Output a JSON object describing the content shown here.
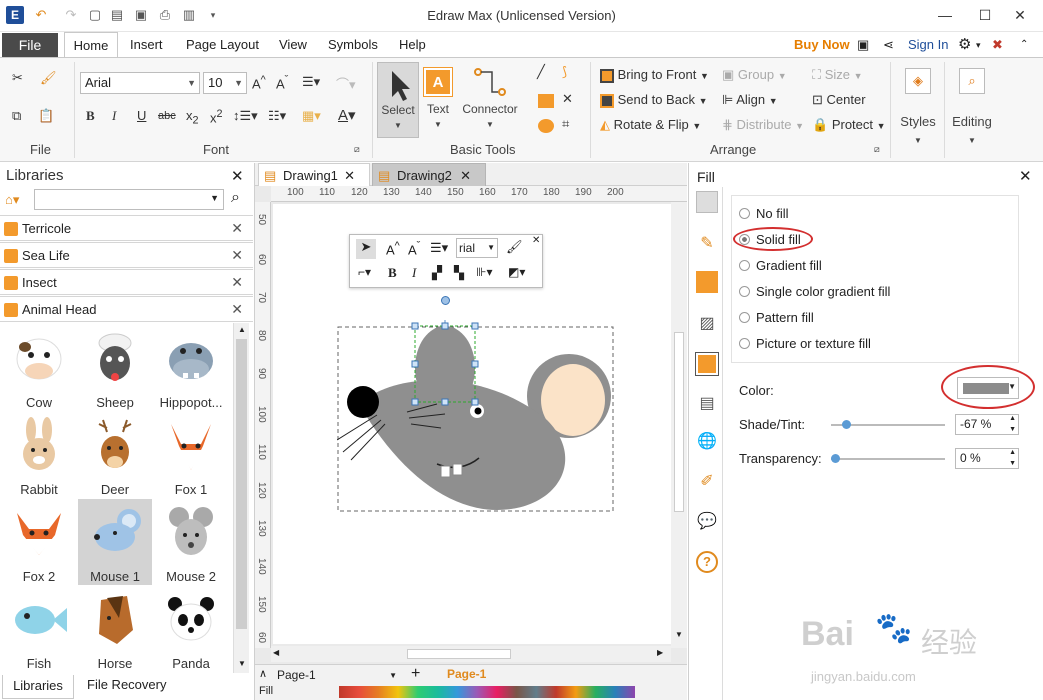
{
  "window": {
    "title": "Edraw Max (Unlicensed Version)"
  },
  "menu": {
    "file": "File",
    "tabs": [
      "Home",
      "Insert",
      "Page Layout",
      "View",
      "Symbols",
      "Help"
    ],
    "buy_now": "Buy Now",
    "sign_in": "Sign In"
  },
  "ribbon": {
    "groups": {
      "file": "File",
      "font": "Font",
      "basic_tools": "Basic Tools",
      "arrange": "Arrange"
    },
    "font_name": "Arial",
    "font_size": "10",
    "select": "Select",
    "text": "Text",
    "connector": "Connector",
    "bring_to_front": "Bring to Front",
    "send_to_back": "Send to Back",
    "rotate_flip": "Rotate & Flip",
    "group": "Group",
    "align": "Align",
    "distribute": "Distribute",
    "size": "Size",
    "center": "Center",
    "protect": "Protect",
    "styles": "Styles",
    "editing": "Editing"
  },
  "libraries": {
    "title": "Libraries",
    "categories": [
      "Terricole",
      "Sea Life",
      "Insect",
      "Animal Head"
    ],
    "shapes": [
      "Cow",
      "Sheep",
      "Hippopot...",
      "Rabbit",
      "Deer",
      "Fox 1",
      "Fox 2",
      "Mouse 1",
      "Mouse 2",
      "Fish",
      "Horse",
      "Panda"
    ],
    "bottom_tabs": [
      "Libraries",
      "File Recovery"
    ]
  },
  "documents": {
    "tabs": [
      "Drawing1",
      "Drawing2"
    ]
  },
  "ruler": {
    "top": [
      "100",
      "110",
      "120",
      "130",
      "140",
      "150",
      "160",
      "170",
      "180",
      "190",
      "200"
    ],
    "left": [
      "50",
      "60",
      "70",
      "80",
      "90",
      "100",
      "110",
      "120",
      "130",
      "140",
      "150",
      "60"
    ]
  },
  "floating_toolbar": {
    "font": "rial"
  },
  "status": {
    "page_select": "Page-1",
    "page_tab": "Page-1",
    "fill_label": "Fill"
  },
  "fill_panel": {
    "title": "Fill",
    "options": [
      "No fill",
      "Solid fill",
      "Gradient fill",
      "Single color gradient fill",
      "Pattern fill",
      "Picture or texture fill"
    ],
    "color_label": "Color:",
    "shade_label": "Shade/Tint:",
    "shade_value": "-67 %",
    "transparency_label": "Transparency:",
    "transparency_value": "0 %",
    "shade_level": 0.1,
    "transparency_level": 0.0,
    "selected_color": "#8c8c8c"
  },
  "watermark": {
    "brand": "Bai",
    "brand_cn": "经验",
    "url": "jingyan.baidu.com"
  },
  "colors": {
    "accent_orange": "#f39a2c",
    "buy_now": "#e67e00",
    "highlight_red": "#d32f2f",
    "mouse_gray": "#8f8f8f",
    "ear_inner": "#fbe3c8"
  }
}
